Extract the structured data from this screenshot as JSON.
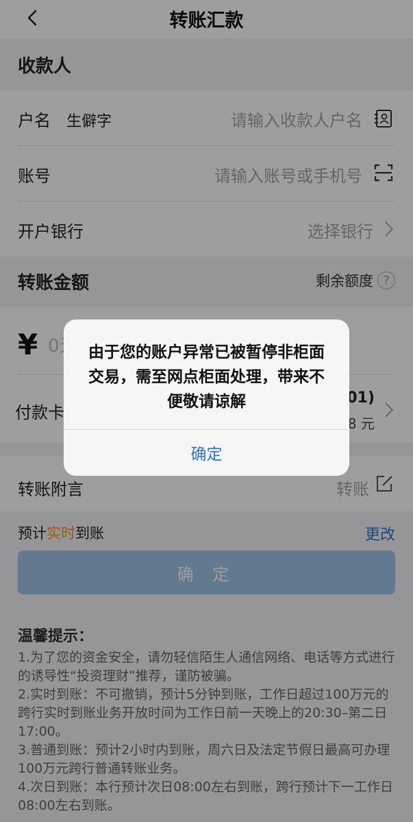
{
  "header": {
    "title": "转账汇款"
  },
  "payee_section": {
    "title": "收款人",
    "name_label": "户名",
    "rare_char_link": "生僻字",
    "name_placeholder": "请输入收款人户名",
    "account_label": "账号",
    "account_placeholder": "请输入账号或手机号",
    "bank_label": "开户银行",
    "bank_placeholder": "选择银行"
  },
  "amount_section": {
    "title": "转账金额",
    "quota_label": "剩余额度",
    "quota_help": "?",
    "currency": "¥",
    "amount_placeholder": "0元"
  },
  "payer": {
    "label": "付款卡",
    "card_suffix": "301)",
    "balance_suffix": "78 元"
  },
  "memo": {
    "label": "转账附言",
    "value": "转账"
  },
  "eta": {
    "prefix": "预计",
    "highlight": "实时",
    "suffix": "到账",
    "change_label": "更改"
  },
  "confirm_button": "确 定",
  "tips": {
    "title": "温馨提示：",
    "items": [
      "1.为了您的资金安全，请勿轻信陌生人通信网络、电话等方式进行的诱导性“投资理财”推荐，谨防被骗。",
      "2.实时到账：不可撤销，预计5分钟到账，工作日超过100万元的跨行实时到账业务开放时间为工作日前一天晚上的20:30–第二日17:00。",
      "3.普通到账：预计2小时内到账，周六日及法定节假日最高可办理100万元跨行普通转账业务。",
      "4.次日到账：本行预计次日08:00左右到账，跨行预计下一工作日08:00左右到账。"
    ]
  },
  "dialog": {
    "message": "由于您的账户异常已被暂停非柜面交易，需至网点柜面处理，带来不便敬请谅解",
    "ok_label": "确定"
  },
  "colors": {
    "accent": "#2a76d8",
    "highlight": "#f0941e",
    "button": "#9fc3e9"
  }
}
